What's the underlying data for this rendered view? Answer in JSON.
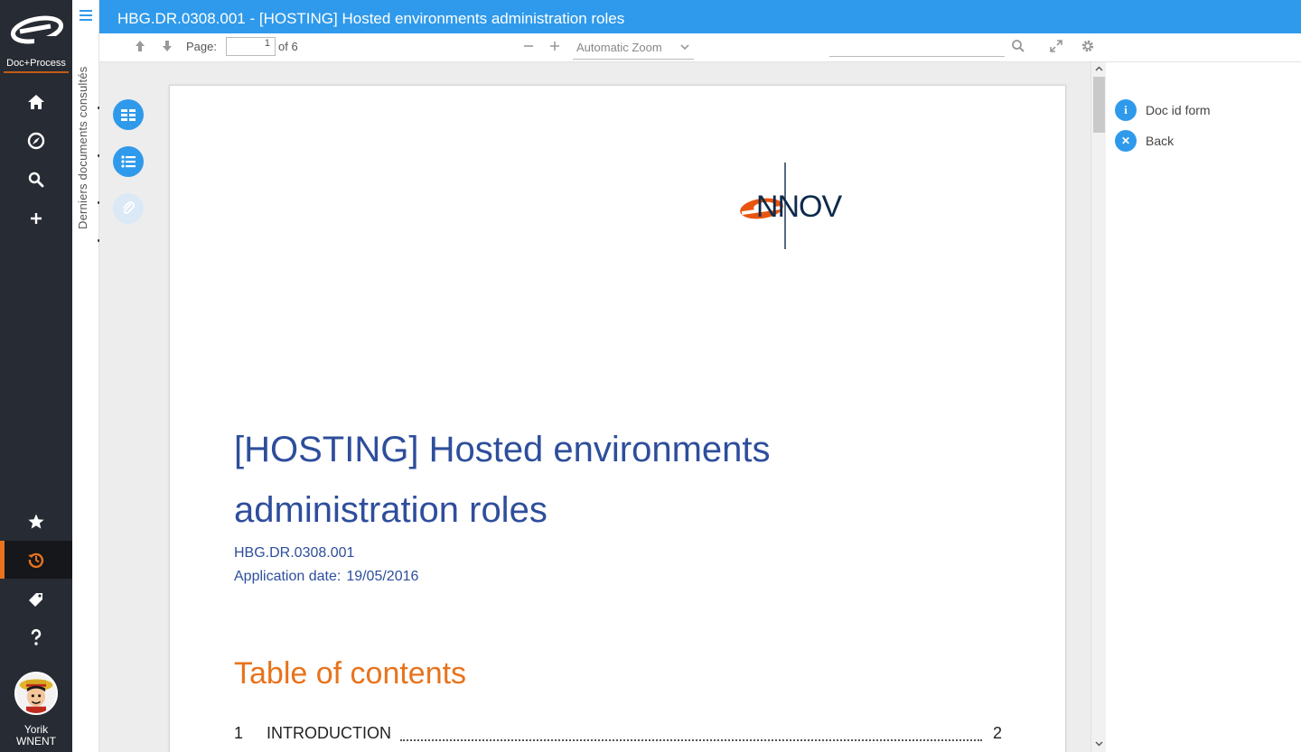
{
  "app": {
    "brand": "Doc+Process",
    "title": "HBG.DR.0308.001 - [HOSTING] Hosted environments administration roles",
    "user": {
      "first_name": "Yorik",
      "last_name": "WNENT"
    },
    "accent": "#2f9aeb",
    "active_color": "#e8731c"
  },
  "leftnav": {
    "top_items": [
      "home-icon",
      "compass-icon",
      "search-icon",
      "plus-icon"
    ],
    "bottom_items": [
      "star-icon",
      "history-icon",
      "tag-icon",
      "help-icon"
    ],
    "active": "history-icon"
  },
  "recent": {
    "label": "Derniers documents consultés"
  },
  "toolbar": {
    "page_label": "Page:",
    "page_value": "1",
    "page_of": "of 6",
    "zoom_value": "Automatic Zoom",
    "search_placeholder": ""
  },
  "document": {
    "logo_text": "eNNOV",
    "title_line1": "[HOSTING] Hosted environments",
    "title_line2": "administration roles",
    "reference": "HBG.DR.0308.001",
    "date_label": "Application date:",
    "date_value": "19/05/2016",
    "toc_title": "Table of contents",
    "toc": [
      {
        "num": "1",
        "label": "INTRODUCTION",
        "page": "2"
      }
    ]
  },
  "rightpanel": {
    "links": [
      {
        "icon": "info-icon",
        "label": "Doc id form"
      },
      {
        "icon": "close-icon",
        "label": "Back"
      }
    ]
  }
}
